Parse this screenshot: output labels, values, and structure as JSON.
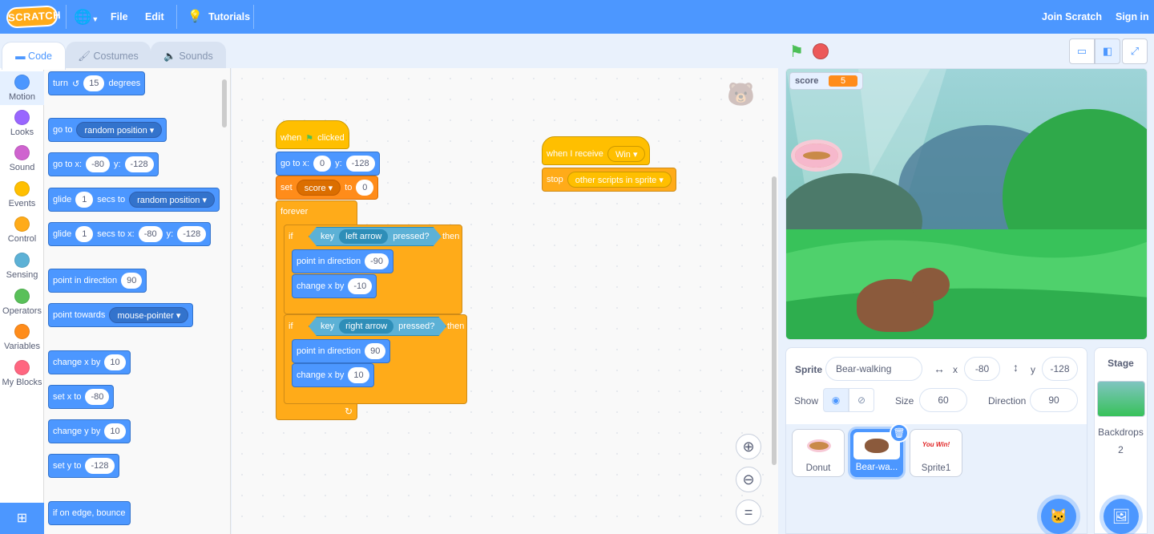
{
  "menubar": {
    "file": "File",
    "edit": "Edit",
    "tutorials": "Tutorials",
    "join": "Join Scratch",
    "signin": "Sign in",
    "logo": "SCRATCH"
  },
  "tabs": {
    "code": "Code",
    "costumes": "Costumes",
    "sounds": "Sounds"
  },
  "categories": [
    {
      "label": "Motion",
      "color": "#4c97ff"
    },
    {
      "label": "Looks",
      "color": "#9966ff"
    },
    {
      "label": "Sound",
      "color": "#cf63cf"
    },
    {
      "label": "Events",
      "color": "#ffbf00"
    },
    {
      "label": "Control",
      "color": "#ffab19"
    },
    {
      "label": "Sensing",
      "color": "#5cb1d6"
    },
    {
      "label": "Operators",
      "color": "#59c059"
    },
    {
      "label": "Variables",
      "color": "#ff8c1a"
    },
    {
      "label": "My Blocks",
      "color": "#ff6680"
    }
  ],
  "palette": {
    "turn": "turn",
    "turn_val": "15",
    "degrees": "degrees",
    "goto": "go to",
    "random_position": "random position",
    "gotoxy": "go to x:",
    "x_val": "-80",
    "y": "y:",
    "y_val": "-128",
    "glide": "glide",
    "glide_secs": "1",
    "secs_to": "secs to",
    "secs_to_x": "secs to x:",
    "point_dir": "point in direction",
    "dir_val": "90",
    "point_towards": "point towards",
    "mouse_pointer": "mouse-pointer",
    "change_x": "change x by",
    "change_x_val": "10",
    "set_x": "set x to",
    "set_x_val": "-80",
    "change_y": "change y by",
    "change_y_val": "10",
    "set_y": "set y to",
    "set_y_val": "-128",
    "bounce": "if on edge, bounce"
  },
  "script1": {
    "when": "when",
    "clicked": "clicked",
    "gotoxy": "go to x:",
    "x": "0",
    "y": "y:",
    "yv": "-128",
    "set": "set",
    "var": "score",
    "to": "to",
    "tov": "0",
    "forever": "forever",
    "if": "if",
    "then": "then",
    "key": "key",
    "pressed": "pressed?",
    "left": "left arrow",
    "right": "right arrow",
    "point": "point in direction",
    "dir1": "-90",
    "dir2": "90",
    "changex": "change x by",
    "dx1": "-10",
    "dx2": "10"
  },
  "script2": {
    "receive": "when I receive",
    "msg": "Win",
    "stop": "stop",
    "stop_opt": "other scripts in sprite"
  },
  "stage": {
    "monitor_label": "score",
    "monitor_value": "5"
  },
  "sprite_info": {
    "sprite_label": "Sprite",
    "sprite_name": "Bear-walking",
    "x_label": "x",
    "x": "-80",
    "y_label": "y",
    "y": "-128",
    "show_label": "Show",
    "size_label": "Size",
    "size": "60",
    "direction_label": "Direction",
    "direction": "90"
  },
  "sprites": [
    {
      "name": "Donut",
      "selected": false
    },
    {
      "name": "Bear-wa...",
      "selected": true
    },
    {
      "name": "Sprite1",
      "selected": false,
      "thumb_text": "You Win!"
    }
  ],
  "stage_pane": {
    "title": "Stage",
    "backdrops_label": "Backdrops",
    "backdrops_count": "2"
  }
}
